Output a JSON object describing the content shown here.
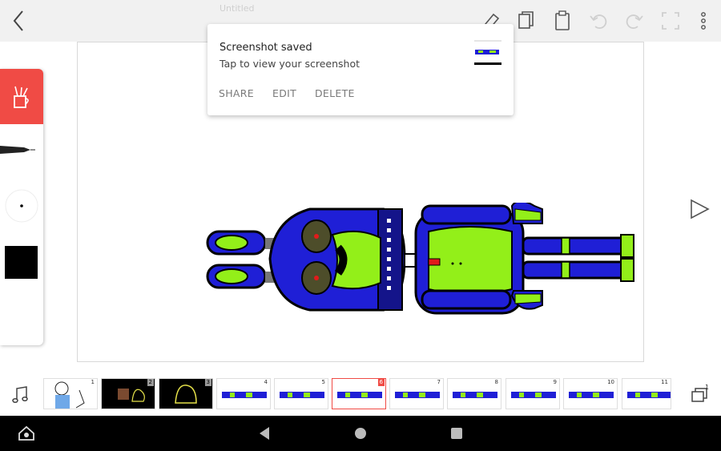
{
  "app": {
    "title_ghost": "Untitled",
    "accent_color": "#f04b45"
  },
  "topbar": {
    "icons": [
      "back-chevron-icon",
      "eraser-icon",
      "copy-icon",
      "paste-icon",
      "undo-icon",
      "redo-icon",
      "fullscreen-icon",
      "more-vert-icon"
    ]
  },
  "tools": {
    "active_tool_icon": "pencil-cup-icon",
    "pen_icon": "pen-icon",
    "brush_size_icon": "brush-size-icon",
    "color_swatch": "#000000"
  },
  "toast": {
    "title": "Screenshot saved",
    "subtitle": "Tap to view your screenshot",
    "actions": [
      "SHARE",
      "EDIT",
      "DELETE"
    ]
  },
  "filmstrip": {
    "frames": [
      {
        "num": "1",
        "kind": "sans"
      },
      {
        "num": "2",
        "kind": "dark-brown"
      },
      {
        "num": "3",
        "kind": "dark-yellow"
      },
      {
        "num": "4",
        "kind": "robot"
      },
      {
        "num": "5",
        "kind": "robot"
      },
      {
        "num": "6",
        "kind": "robot",
        "selected": true
      },
      {
        "num": "7",
        "kind": "robot"
      },
      {
        "num": "8",
        "kind": "robot"
      },
      {
        "num": "9",
        "kind": "robot"
      },
      {
        "num": "10",
        "kind": "robot"
      },
      {
        "num": "11",
        "kind": "robot"
      }
    ],
    "layers_count": "1"
  },
  "navbar": {
    "icons": [
      "home-icon",
      "back-triangle-icon",
      "home-circle-icon",
      "recents-square-icon"
    ]
  }
}
